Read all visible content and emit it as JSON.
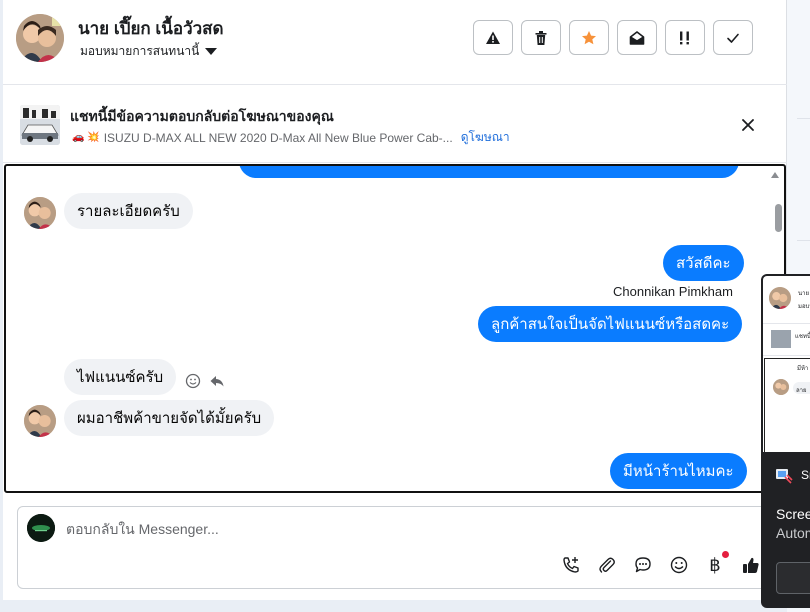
{
  "header": {
    "contact_name": "นาย เปี๊ยก เนื้อวัวสด",
    "assign_label": "มอบหมายการสนทนานี้",
    "actions": [
      {
        "name": "report-spam-button",
        "icon": "warning-icon"
      },
      {
        "name": "delete-button",
        "icon": "trash-icon"
      },
      {
        "name": "follow-up-button",
        "icon": "star-icon",
        "color": "#f7923a"
      },
      {
        "name": "mark-unread-button",
        "icon": "envelope-open-icon"
      },
      {
        "name": "priority-button",
        "icon": "exclamation-icon"
      },
      {
        "name": "mark-done-button",
        "icon": "check-icon"
      }
    ]
  },
  "ad_banner": {
    "title": "แชทนี้มีข้อความตอบกลับต่อโฆษณาของคุณ",
    "emoji": "🚗 💥",
    "description": "ISUZU D-MAX ALL NEW 2020 D-Max All New Blue Power Cab-...",
    "link_label": "ดูโฆษณา",
    "close_icon": "close-icon"
  },
  "messages": [
    {
      "direction": "in",
      "text": "รายละเอียดครับ"
    },
    {
      "direction": "out",
      "text": "สวัสดีคะ"
    },
    {
      "direction": "out",
      "sender": "Chonnikan Pimkham",
      "text": "ลูกค้าสนใจเป็นจัดไฟแนนซ์หรือสดคะ"
    },
    {
      "direction": "in",
      "text": "ไฟแนนซ์ครับ"
    },
    {
      "direction": "in",
      "text": "ผมอาชีพค้าขายจัดได้มั้ยครับ"
    },
    {
      "direction": "out",
      "text": "มีหน้าร้านไหมคะ"
    }
  ],
  "composer": {
    "placeholder": "ตอบกลับใน Messenger...",
    "value": "",
    "tools": [
      "call-icon",
      "attachment-icon",
      "saved-replies-icon",
      "emoji-icon",
      "payment-icon",
      "like-icon"
    ],
    "baht_symbol": "฿",
    "notification_color": "#e41e3f"
  },
  "overlay": {
    "mini_name": "นาย",
    "mini_sub": "มอบห",
    "mini_ad": "แชทนี้",
    "mini_msg": "มีห้า",
    "mini_bubble": "ลาย",
    "app_label": "Sn",
    "line1": "Scree",
    "line2": "Autom"
  },
  "colors": {
    "outgoing_bubble": "#0a7cff",
    "incoming_bubble": "#f0f2f5",
    "link": "#216fdb"
  }
}
